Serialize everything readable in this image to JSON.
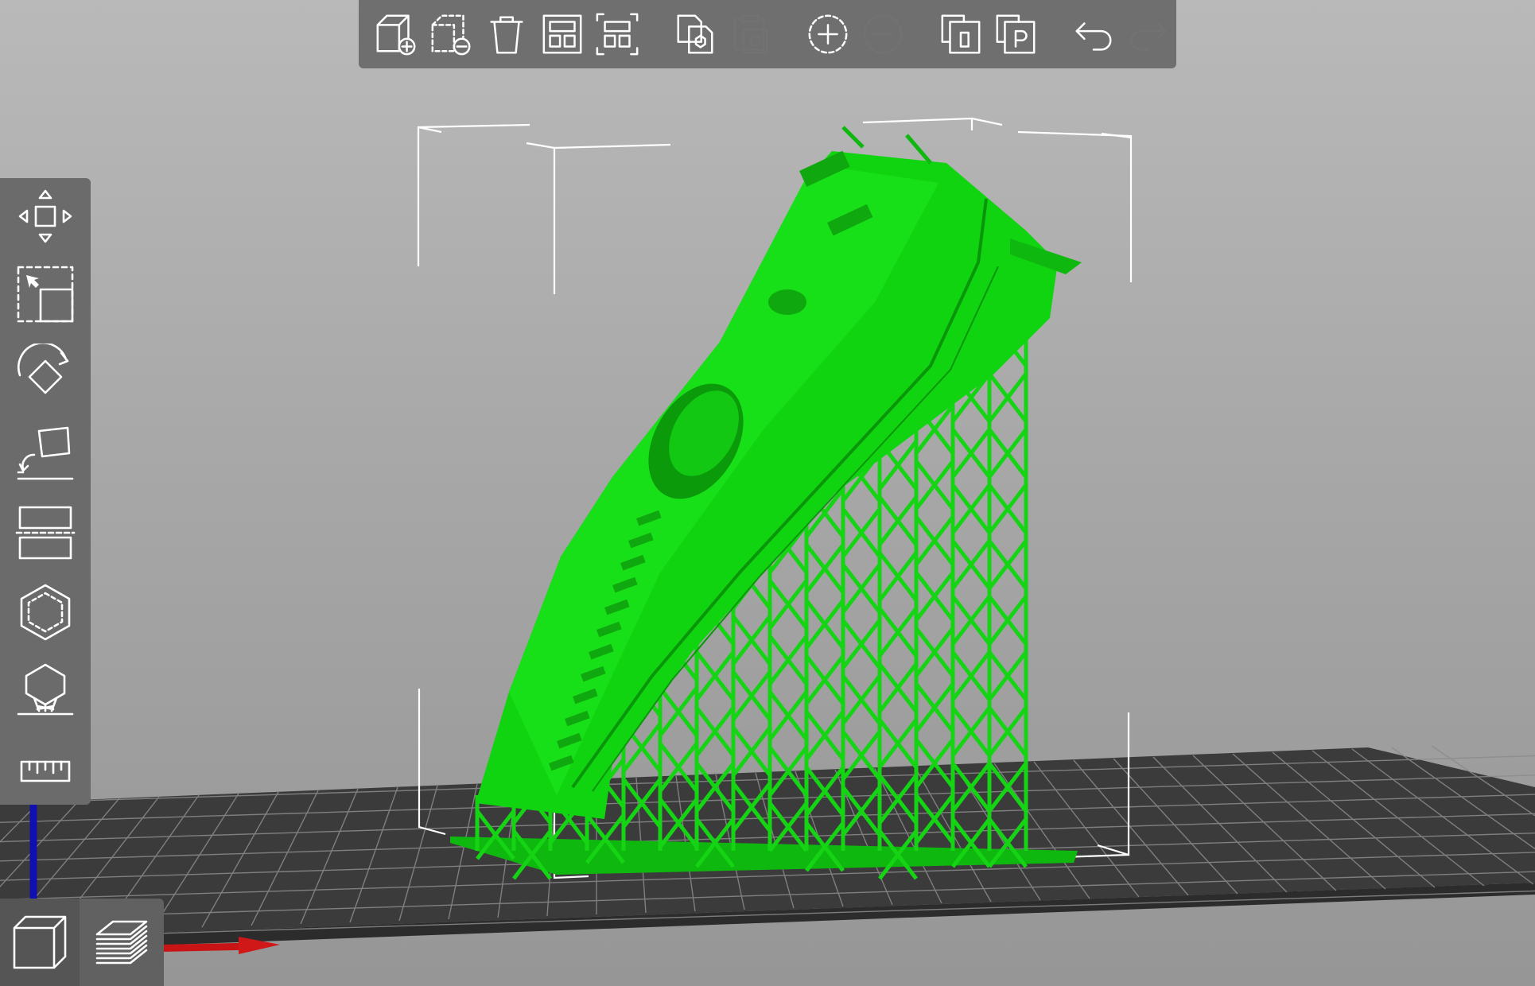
{
  "viewport": {
    "model_color": "#11d711",
    "model_shade": "#0a9e0a",
    "bed_color": "#3a3a3a",
    "grid_color": "#8a8a8a",
    "axis_x_color": "#d01010",
    "axis_y_color": "#10a010",
    "axis_z_color": "#1010c0",
    "background_top": "#b9b9b9",
    "background_bottom": "#969696"
  },
  "top_toolbar": {
    "buttons": [
      {
        "icon": "add-object-icon",
        "enabled": true
      },
      {
        "icon": "delete-object-icon",
        "enabled": true
      },
      {
        "icon": "delete-all-icon",
        "enabled": true
      },
      {
        "icon": "arrange-icon",
        "enabled": true
      },
      {
        "icon": "arrange-selection-icon",
        "enabled": true
      },
      {
        "icon": "copy-icon",
        "enabled": true
      },
      {
        "icon": "paste-icon",
        "enabled": false
      },
      {
        "icon": "add-instance-icon",
        "enabled": true
      },
      {
        "icon": "remove-instance-icon",
        "enabled": false
      },
      {
        "icon": "split-to-objects-icon",
        "enabled": true
      },
      {
        "icon": "split-to-parts-icon",
        "enabled": true
      },
      {
        "icon": "undo-icon",
        "enabled": true
      },
      {
        "icon": "redo-icon",
        "enabled": false
      }
    ]
  },
  "left_toolbar": {
    "buttons": [
      {
        "icon": "move-icon"
      },
      {
        "icon": "scale-icon"
      },
      {
        "icon": "rotate-icon"
      },
      {
        "icon": "place-on-face-icon"
      },
      {
        "icon": "cut-icon"
      },
      {
        "icon": "hollow-icon"
      },
      {
        "icon": "sla-supports-icon"
      },
      {
        "icon": "measure-icon"
      }
    ]
  },
  "view_switch": {
    "active": "3d",
    "buttons": [
      {
        "icon": "3d-view-icon"
      },
      {
        "icon": "preview-layers-icon"
      }
    ]
  }
}
